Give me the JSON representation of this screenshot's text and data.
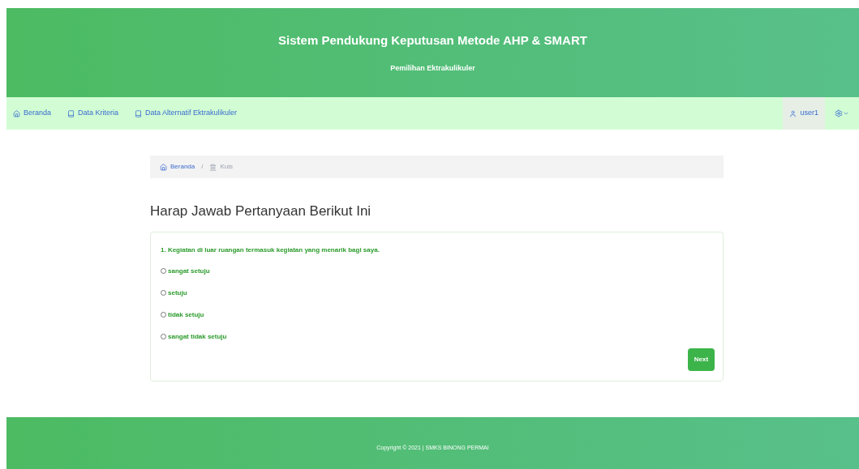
{
  "header": {
    "title": "Sistem Pendukung Keputusan Metode AHP & SMART",
    "subtitle": "Pemilihan Ektrakulikuler"
  },
  "nav": {
    "items": [
      {
        "label": "Beranda"
      },
      {
        "label": "Data Kriteria"
      },
      {
        "label": "Data Alternatif Ektrakulikuler"
      }
    ],
    "user": "user1"
  },
  "breadcrumb": [
    {
      "label": "Beranda"
    },
    {
      "label": "Kuis"
    }
  ],
  "breadcrumb_separator": "/",
  "heading": "Harap Jawab Pertanyaan Berikut Ini",
  "question": "1. Kegiatan di luar ruangan termasuk kegiatan yang menarik bagi saya.",
  "options": [
    {
      "label": "sangat setuju",
      "selected": false
    },
    {
      "label": "setuju",
      "selected": false
    },
    {
      "label": "tidak setuju",
      "selected": false
    },
    {
      "label": "sangat tidak setuju",
      "selected": false
    }
  ],
  "next_button": "Next",
  "footer": "Copyright © 2021 | SMKS BINONG PERMAI"
}
